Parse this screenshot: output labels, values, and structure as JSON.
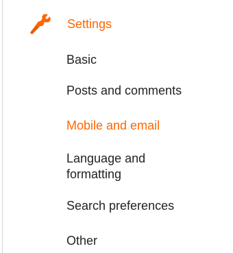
{
  "colors": {
    "accent": "#ff6600",
    "text": "#222222",
    "border": "#d6d6d6"
  },
  "nav": {
    "section": {
      "label": "Settings",
      "icon": "wrench-icon"
    },
    "items": [
      {
        "label": "Basic",
        "active": false
      },
      {
        "label": "Posts and comments",
        "active": false
      },
      {
        "label": "Mobile and email",
        "active": true
      },
      {
        "label": "Language and formatting",
        "active": false
      },
      {
        "label": "Search preferences",
        "active": false
      },
      {
        "label": "Other",
        "active": false
      }
    ]
  }
}
